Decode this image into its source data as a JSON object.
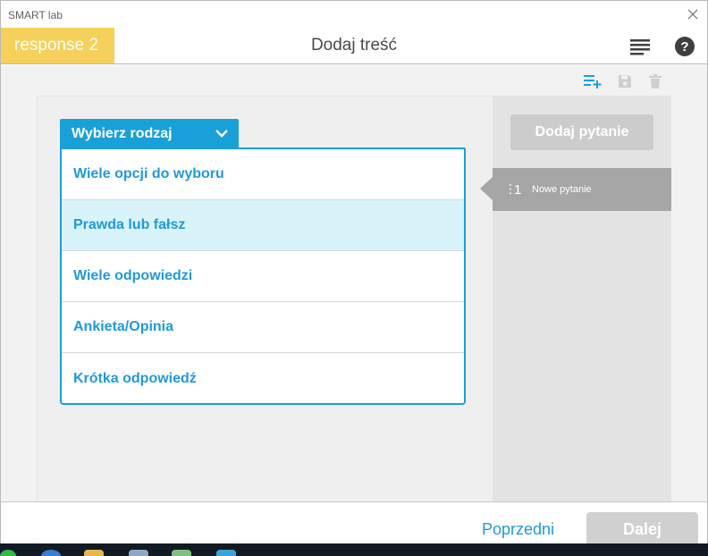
{
  "window": {
    "app_title": "SMART lab"
  },
  "header": {
    "activity_name": "response 2",
    "page_title": "Dodaj treść"
  },
  "toolbar": {
    "icons": [
      "add-list-icon",
      "save-icon",
      "trash-icon"
    ]
  },
  "editor": {
    "type_select": {
      "label": "Wybierz rodzaj"
    },
    "options": [
      {
        "label": "Wiele opcji do wyboru"
      },
      {
        "label": "Prawda lub fałsz"
      },
      {
        "label": "Wiele odpowiedzi"
      },
      {
        "label": "Ankieta/Opinia"
      },
      {
        "label": "Krótka odpowiedź"
      }
    ]
  },
  "sidebar": {
    "add_question_label": "Dodaj pytanie",
    "questions": [
      {
        "number": "1",
        "label": "Nowe pytanie"
      }
    ]
  },
  "footer": {
    "prev_label": "Poprzedni",
    "next_label": "Dalej"
  },
  "colors": {
    "accent_blue": "#1aa0d8",
    "activity_yellow": "#f5d05b",
    "hover_bg": "#d9f3fb",
    "disabled_gray": "#cccccc"
  }
}
